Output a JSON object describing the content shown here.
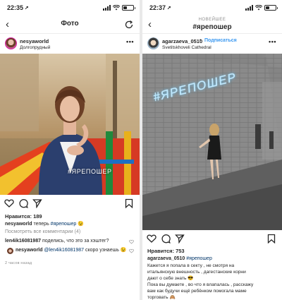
{
  "left": {
    "status": {
      "time": "22:35"
    },
    "nav": {
      "title": "Фото"
    },
    "post": {
      "username": "nesyaworld",
      "location": "Долгопрудный",
      "photo_overlay": "#ЯРЕПОШЕР",
      "likes": "Нравится: 189",
      "caption_user": "nesyaworld",
      "caption_text": "теперь",
      "caption_tag": "#ярепошер",
      "caption_emoji": "😉",
      "view_all": "Посмотреть все комментарии (4)",
      "comments": [
        {
          "user": "len4ik16081987",
          "text": "поделись, что это за хэштег?"
        },
        {
          "user": "nesyaworld",
          "mention": "@len4ik16081987",
          "text": "скоро узнаешь",
          "emoji": "😉"
        }
      ],
      "time_ago": "2 часов назад"
    }
  },
  "right": {
    "status": {
      "time": "22:37"
    },
    "nav": {
      "subtitle": "НОВЕЙШЕЕ",
      "title": "#ярепошер"
    },
    "post": {
      "username": "agarzaeva_0510",
      "follow": "Подписаться",
      "location": "Svetitskhoveli Cathedral",
      "photo_overlay": "#ЯРЕПОШЕР",
      "likes": "Нравится: 753",
      "caption_user": "agarzaeva_0510",
      "caption_tag": "#ярепошер",
      "caption_lines": [
        "Кажется я попала в секту , не смотря на",
        "итальянскую внешность , дагестанские корни",
        "дают о себе знать 😎",
        "Пока вы думаете , во что я влапалась , расскажу",
        "вам как будучи ещё ребёнком помогала маме",
        "торговать 🙈"
      ]
    }
  },
  "icons": [
    "back-chevron-icon",
    "refresh-icon",
    "more-icon",
    "heart-icon",
    "comment-icon",
    "share-icon",
    "bookmark-icon"
  ],
  "colors": {
    "link": "#3897f0",
    "hashtag": "#003569",
    "muted": "#8e8e8e"
  }
}
